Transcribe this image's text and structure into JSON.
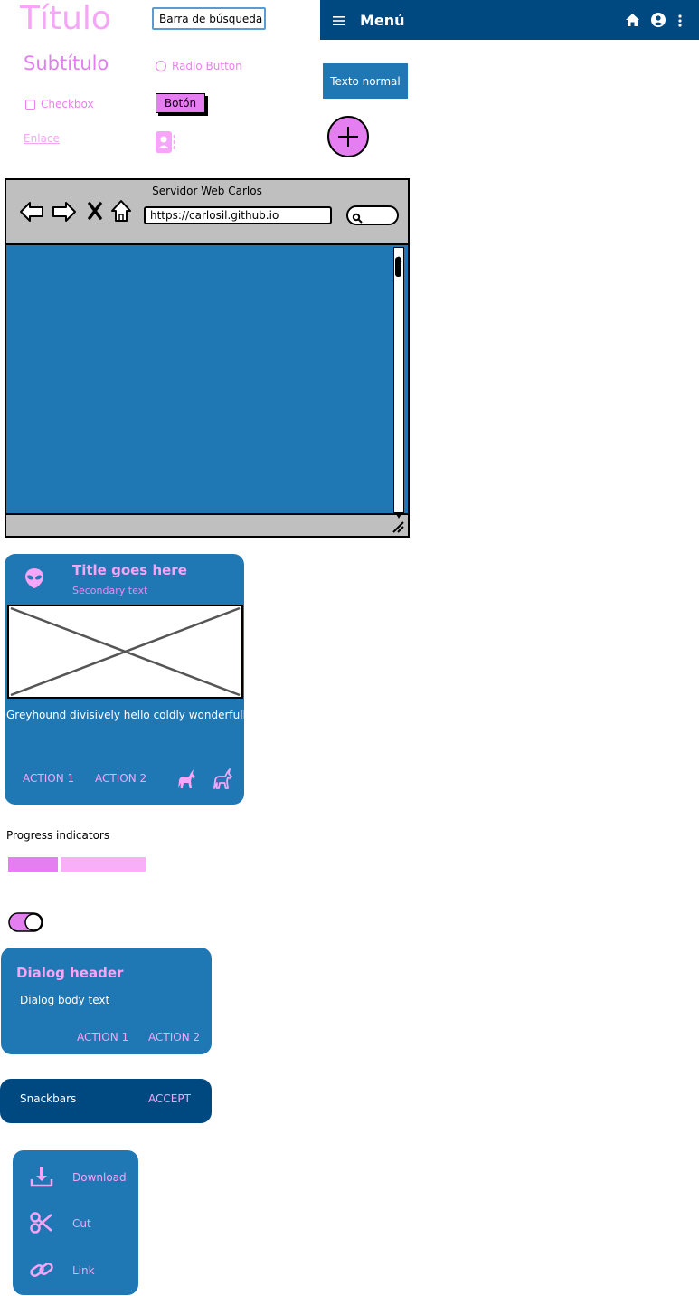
{
  "palette": {
    "pink": "#e57ef0",
    "light_pink": "#f5a6f7",
    "blue": "#1f77b4",
    "dark_blue": "#004880",
    "link_blue": "#5b9bd5"
  },
  "widgets": {
    "title": "Título",
    "subtitle": "Subtítulo",
    "checkbox_label": "Checkbox",
    "link_label": "Enlace",
    "search_value": "Barra de búsqueda",
    "radio_label": "Radio Button",
    "button_label": "Botón",
    "contact_icon": "contact-card-icon",
    "normal_text": "Texto normal",
    "fab_icon": "plus-icon"
  },
  "topbar": {
    "title": "Menú",
    "left_icon": "hamburger-icon",
    "right_icons": [
      "home-icon",
      "account-icon",
      "more-vert-icon"
    ]
  },
  "browser": {
    "title": "Servidor Web Carlos",
    "url": "https://carlosil.github.io",
    "nav_icons": [
      "back-arrow-icon",
      "forward-arrow-icon",
      "stop-icon",
      "home-icon"
    ],
    "search_icon": "search-icon"
  },
  "card": {
    "title": "Title goes here",
    "secondary": "Secondary text",
    "avatar_icon": "alien-icon",
    "body": "Greyhound divisively hello coldly wonderfull",
    "action1": "ACTION 1",
    "action2": "ACTION 2",
    "action_icons": [
      "unicorn-filled-icon",
      "unicorn-outline-icon"
    ]
  },
  "progress": {
    "label": "Progress indicators",
    "value_fraction": 0.36
  },
  "toggle": {
    "on": true
  },
  "dialog": {
    "header": "Dialog header",
    "body": "Dialog body text",
    "action1": "ACTION 1",
    "action2": "ACTION 2"
  },
  "snackbar": {
    "text": "Snackbars",
    "action": "ACCEPT"
  },
  "menu": {
    "items": [
      {
        "label": "Download",
        "icon": "download-icon"
      },
      {
        "label": "Cut",
        "icon": "scissors-icon"
      },
      {
        "label": "Link",
        "icon": "link-icon"
      }
    ]
  }
}
